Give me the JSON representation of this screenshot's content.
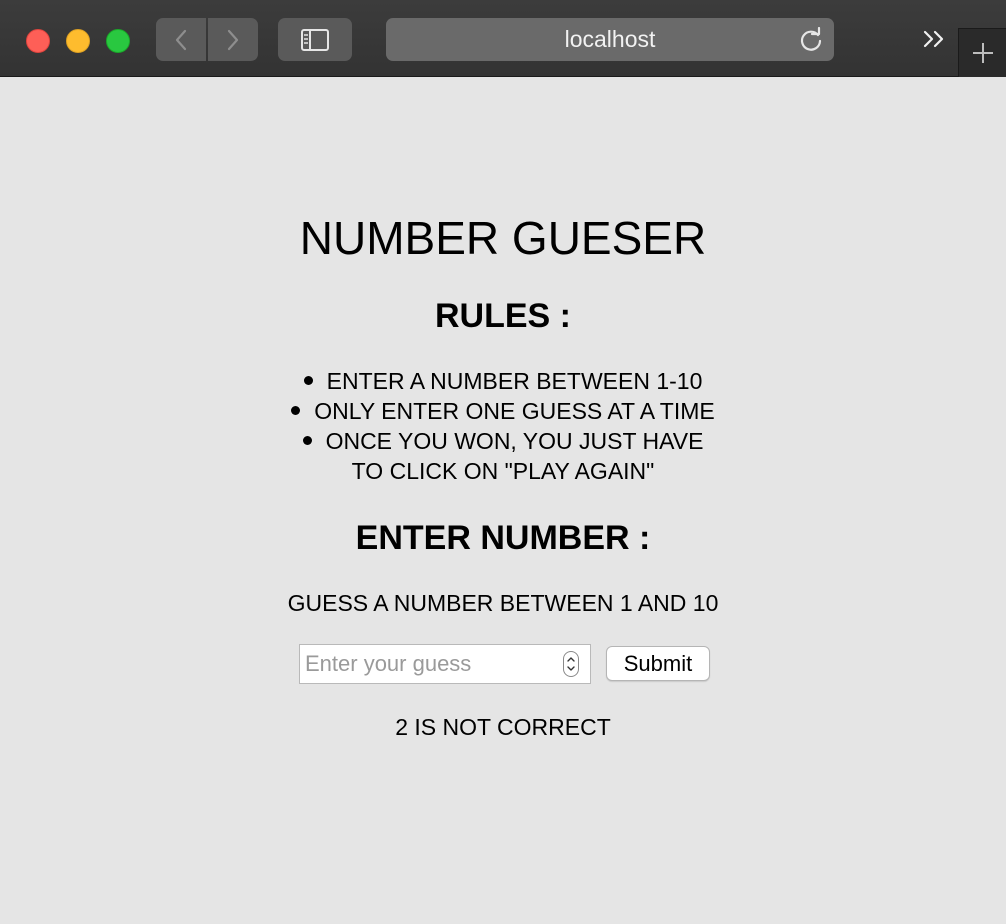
{
  "browser": {
    "url": "localhost"
  },
  "page": {
    "title": "NUMBER GUESER",
    "rules_heading": "RULES :",
    "rules": [
      "ENTER A NUMBER BETWEEN 1-10",
      "ONLY ENTER ONE GUESS AT A TIME",
      "ONCE YOU WON, YOU JUST HAVE",
      "TO CLICK ON \"PLAY AGAIN\""
    ],
    "enter_heading": "ENTER NUMBER :",
    "instruction": "GUESS A NUMBER BETWEEN 1 AND 10",
    "guess_input": {
      "value": "",
      "placeholder": "Enter your guess"
    },
    "submit_label": "Submit",
    "result": "2 IS NOT CORRECT"
  },
  "icons": {
    "back": "chevron-left-icon",
    "forward": "chevron-right-icon",
    "sidebar": "sidebar-icon",
    "reload": "reload-icon",
    "more": "double-chevron-right-icon",
    "new_tab": "plus-icon"
  },
  "colors": {
    "close": "#fe5f57",
    "minimize": "#febc2e",
    "maximize": "#29c840",
    "page_background": "#e5e5e5"
  }
}
